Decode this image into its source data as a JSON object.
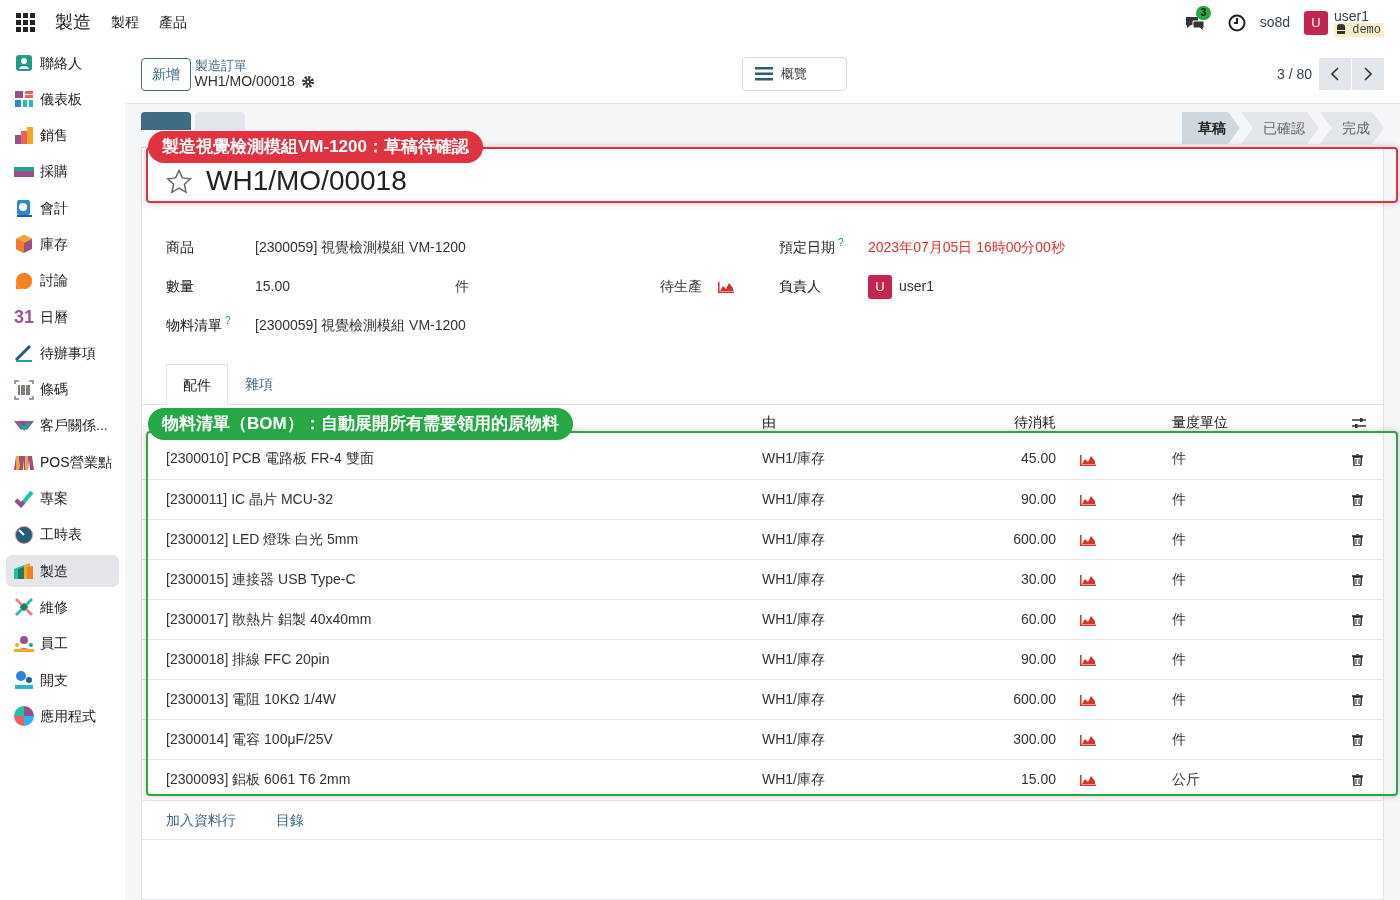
{
  "topbar": {
    "app_name": "製造",
    "menu": [
      "製程",
      "產品"
    ],
    "messages_count": "3",
    "company": "so8d",
    "avatar": "U",
    "user": "user1",
    "database": "demo"
  },
  "sidebar": {
    "items": [
      {
        "label": "聯絡人",
        "kind": "contacts",
        "selected": false
      },
      {
        "label": "儀表板",
        "kind": "dashboard",
        "selected": false
      },
      {
        "label": "銷售",
        "kind": "sales",
        "selected": false
      },
      {
        "label": "採購",
        "kind": "purchase",
        "selected": false
      },
      {
        "label": "會計",
        "kind": "accounting",
        "selected": false
      },
      {
        "label": "庫存",
        "kind": "inventory",
        "selected": false
      },
      {
        "label": "討論",
        "kind": "discuss",
        "selected": false
      },
      {
        "label": "日曆",
        "kind": "calendar",
        "icon_text": "31",
        "selected": false
      },
      {
        "label": "待辦事項",
        "kind": "todo",
        "selected": false
      },
      {
        "label": "條碼",
        "kind": "barcode",
        "selected": false
      },
      {
        "label": "客戶關係...",
        "kind": "crm",
        "selected": false
      },
      {
        "label": "POS營業點",
        "kind": "pos",
        "selected": false
      },
      {
        "label": "專案",
        "kind": "project",
        "selected": false
      },
      {
        "label": "工時表",
        "kind": "timesheet",
        "selected": false
      },
      {
        "label": "製造",
        "kind": "manufacturing",
        "selected": true
      },
      {
        "label": "維修",
        "kind": "repair",
        "selected": false
      },
      {
        "label": "員工",
        "kind": "employees",
        "selected": false
      },
      {
        "label": "開支",
        "kind": "expenses",
        "selected": false
      },
      {
        "label": "應用程式",
        "kind": "apps",
        "selected": false
      }
    ]
  },
  "control_panel": {
    "new_button": "新增",
    "breadcrumb": "製造訂單",
    "record": "WH1/MO/00018",
    "overview_button": "概覽",
    "pager": "3 / 80"
  },
  "status_bar": {
    "buttons": [
      {
        "kind": "primary"
      },
      {
        "kind": "secondary"
      }
    ],
    "stages": [
      {
        "label": "草稿",
        "selected": true
      },
      {
        "label": "已確認",
        "selected": false
      },
      {
        "label": "完成",
        "selected": false
      }
    ]
  },
  "form": {
    "title": "WH1/MO/00018",
    "favorite": false,
    "left_fields": [
      {
        "label": "商品",
        "value": "[2300059] 視覺檢測模組 VM-1200",
        "kind": "text",
        "help": false
      },
      {
        "label": "數量",
        "value": "15.00",
        "unit": "件",
        "status": "待生產",
        "kind": "quantity",
        "help": false
      },
      {
        "label": "物料清單",
        "value": "[2300059] 視覺檢測模組 VM-1200",
        "kind": "text",
        "help": true
      }
    ],
    "right_fields": [
      {
        "label": "預定日期",
        "value": "2023年07月05日 16時00分00秒",
        "kind": "date",
        "help": true
      },
      {
        "label": "負責人",
        "value": "user1",
        "avatar": "U",
        "kind": "user",
        "help": false
      }
    ],
    "help_mark": "?",
    "tabs": [
      {
        "label": "配件",
        "selected": true
      },
      {
        "label": "雜項",
        "selected": false
      }
    ],
    "table": {
      "columns": [
        {
          "label": "由"
        },
        {
          "label": "待消耗"
        },
        {
          "label": "量度單位"
        }
      ],
      "rows": [
        {
          "product": "[2300010] PCB 電路板 FR-4 雙面",
          "from": "WH1/庫存",
          "quantity": "45.00",
          "uom": "件"
        },
        {
          "product": "[2300011] IC 晶片 MCU-32",
          "from": "WH1/庫存",
          "quantity": "90.00",
          "uom": "件"
        },
        {
          "product": "[2300012] LED 燈珠 白光 5mm",
          "from": "WH1/庫存",
          "quantity": "600.00",
          "uom": "件"
        },
        {
          "product": "[2300015] 連接器 USB Type-C",
          "from": "WH1/庫存",
          "quantity": "30.00",
          "uom": "件"
        },
        {
          "product": "[2300017] 散熱片 鋁製 40x40mm",
          "from": "WH1/庫存",
          "quantity": "60.00",
          "uom": "件"
        },
        {
          "product": "[2300018] 排線 FFC 20pin",
          "from": "WH1/庫存",
          "quantity": "90.00",
          "uom": "件"
        },
        {
          "product": "[2300013] 電阻 10KΩ 1/4W",
          "from": "WH1/庫存",
          "quantity": "600.00",
          "uom": "件"
        },
        {
          "product": "[2300014] 電容 100μF/25V",
          "from": "WH1/庫存",
          "quantity": "300.00",
          "uom": "件"
        },
        {
          "product": "[2300093] 鋁板 6061 T6 2mm",
          "from": "WH1/庫存",
          "quantity": "15.00",
          "uom": "公斤"
        }
      ]
    },
    "footer_links": [
      "加入資料行",
      "目錄"
    ]
  },
  "annotations": [
    {
      "text": "製造視覺檢測模組VM-1200：草稿待確認",
      "color": "#e0323f"
    },
    {
      "text": "物料清單（BOM）：自動展開所有需要領用的原物料",
      "color": "#28a745"
    }
  ]
}
